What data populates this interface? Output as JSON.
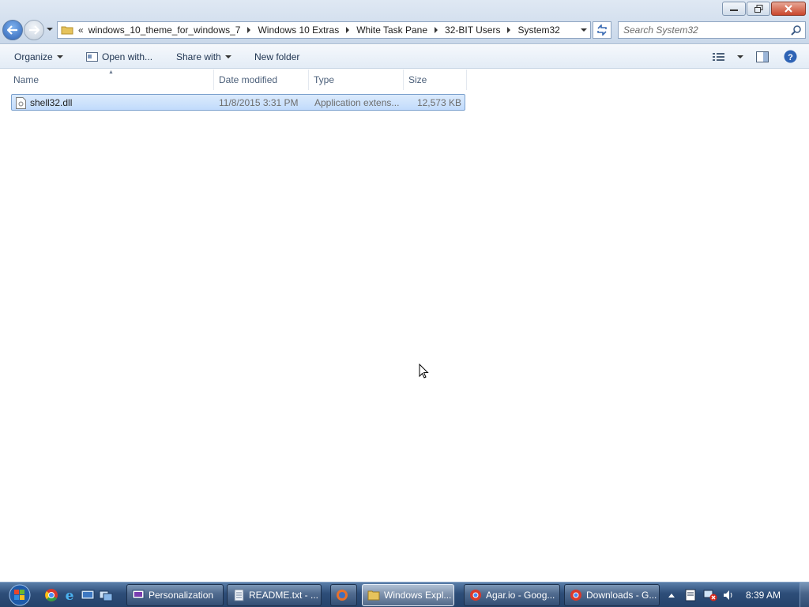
{
  "window": {
    "controls": [
      "minimize",
      "maximize",
      "close"
    ]
  },
  "address": {
    "overflow": "«",
    "crumbs": [
      "windows_10_theme_for_windows_7",
      "Windows 10 Extras",
      "White Task Pane",
      "32-BIT Users",
      "System32"
    ]
  },
  "search": {
    "placeholder": "Search System32"
  },
  "toolbar": {
    "organize": "Organize",
    "open_with": "Open with...",
    "share_with": "Share with",
    "new_folder": "New folder"
  },
  "columns": {
    "name": "Name",
    "date": "Date modified",
    "type": "Type",
    "size": "Size"
  },
  "files": [
    {
      "name": "shell32.dll",
      "date": "11/8/2015 3:31 PM",
      "type": "Application extens...",
      "size": "12,573 KB",
      "selected": true
    }
  ],
  "taskbar": {
    "quick_launch": [
      "chrome-icon",
      "ie-icon",
      "desktop-icon",
      "window-switch-icon"
    ],
    "buttons": [
      {
        "label": "Personalization",
        "icon": "personalization-icon"
      },
      {
        "label": "README.txt - ...",
        "icon": "notepad-icon"
      },
      {
        "label": "",
        "icon": "firefox-icon"
      },
      {
        "label": "Windows Expl...",
        "icon": "explorer-icon",
        "active": true
      },
      {
        "label": "Agar.io - Goog...",
        "icon": "chrome-icon"
      },
      {
        "label": "Downloads - G...",
        "icon": "chrome-icon"
      }
    ],
    "clock": "8:39 AM"
  },
  "colors": {
    "selection": "#cce2fc",
    "taskbar": "#2d4d78",
    "titlebar": "#c9d8ea"
  }
}
